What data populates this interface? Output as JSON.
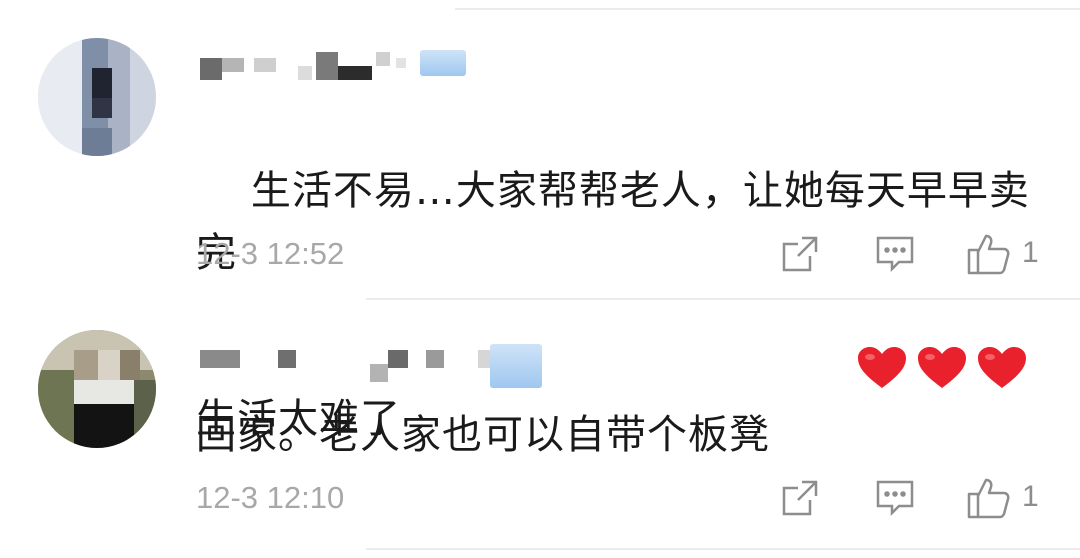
{
  "comments": [
    {
      "text": "生活不易…大家帮帮老人，让她每天早早卖完\n回家。老人家也可以自带个板凳",
      "emoji_count": 3,
      "timestamp": "12-3 12:52",
      "like_count": "1",
      "actions": [
        "share-icon",
        "reply-icon",
        "like-icon"
      ]
    },
    {
      "text": "生活太难了",
      "timestamp": "12-3 12:10",
      "like_count": "1",
      "actions": [
        "share-icon",
        "reply-icon",
        "like-icon"
      ]
    }
  ],
  "colors": {
    "text": "#1a1a1a",
    "meta": "#a8a8a8",
    "icon": "#8d8d8d",
    "heart": "#e8212c",
    "divider": "#ececec",
    "vip_badge": "#9ec7f0"
  }
}
